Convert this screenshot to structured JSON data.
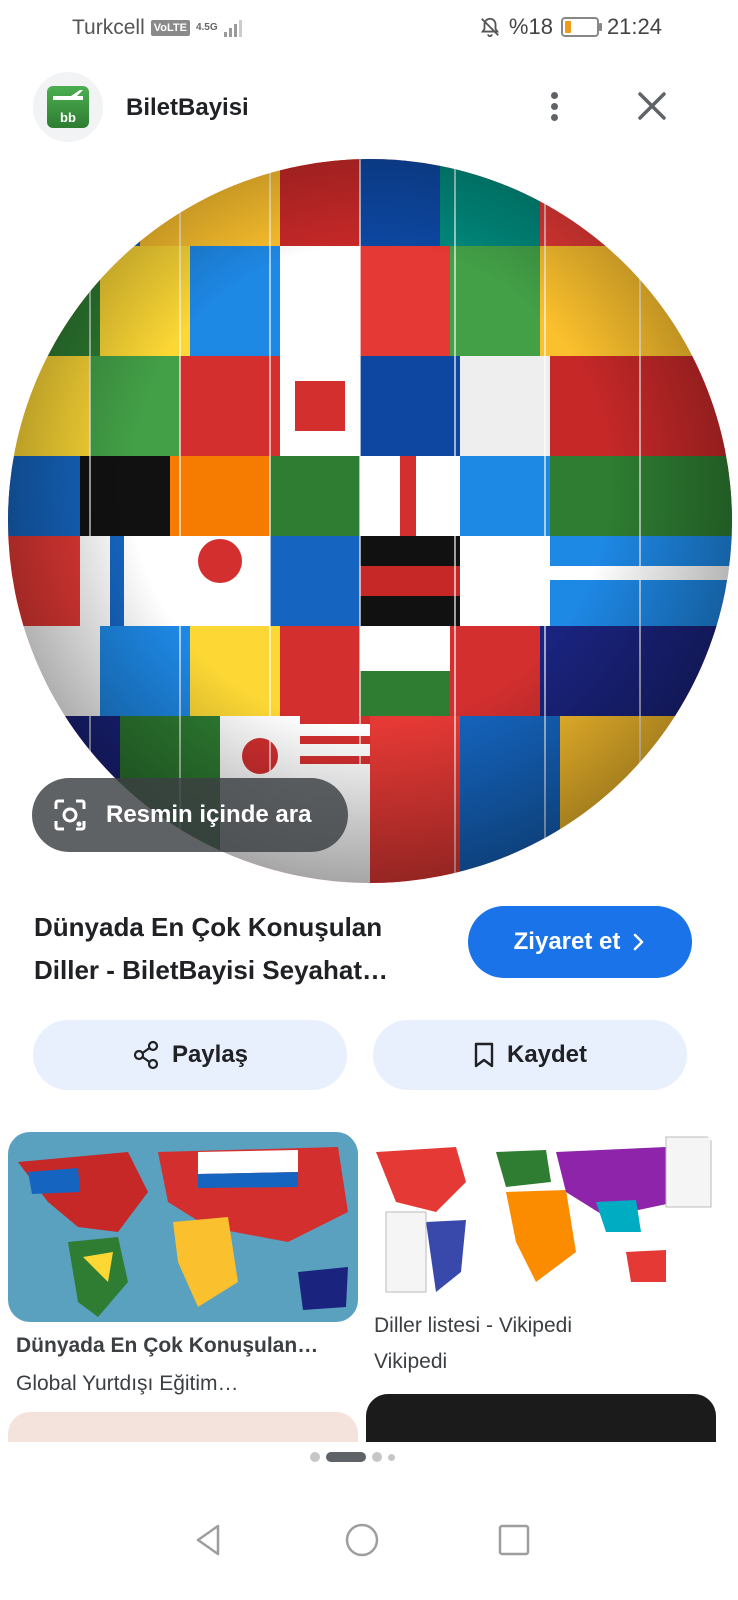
{
  "status_bar": {
    "carrier": "Turkcell",
    "volte": "VoLTE",
    "network": "4.5G",
    "battery": "%18",
    "time": "21:24"
  },
  "header": {
    "site_name": "BiletBayisi",
    "logo_text": "bb"
  },
  "hero": {
    "lens_chip_label": "Resmin içinde ara"
  },
  "result": {
    "title_line1": "Dünyada En Çok Konuşulan",
    "title_line2": "Diller - BiletBayisi Seyahat…",
    "visit_label": "Ziyaret et"
  },
  "actions": {
    "share_label": "Paylaş",
    "save_label": "Kaydet"
  },
  "related": [
    {
      "title": "Dünyada En Çok Konuşulan…",
      "source": "Global Yurtdışı Eğitim…"
    },
    {
      "title": "Diller listesi - Vikipedi",
      "source": "Vikipedi"
    }
  ],
  "colors": {
    "accent": "#1a73e8",
    "chip_bg": "#e8f0fe"
  }
}
